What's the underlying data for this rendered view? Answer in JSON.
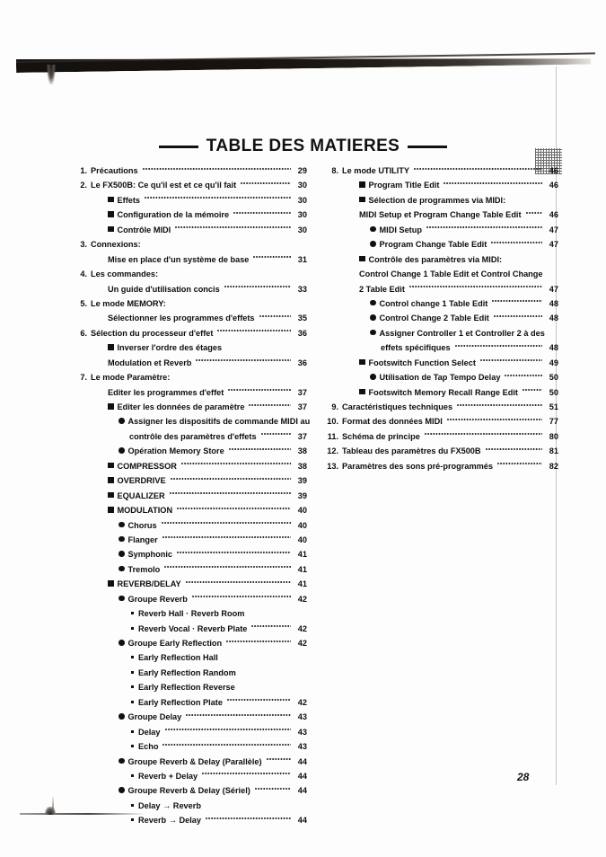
{
  "document": {
    "title": "TABLE DES MATIERES",
    "page_number": "28"
  },
  "toc": {
    "left_column": [
      {
        "num": "1.",
        "bullet": "none",
        "indent": 0,
        "label": "Précautions",
        "page": "29",
        "leader": true
      },
      {
        "num": "2.",
        "bullet": "none",
        "indent": 0,
        "label": "Le FX500B: Ce qu'il est et ce qu'il fait",
        "page": "30",
        "leader": true
      },
      {
        "num": "",
        "bullet": "square",
        "indent": 1,
        "label": "Effets",
        "page": "30",
        "leader": true
      },
      {
        "num": "",
        "bullet": "square",
        "indent": 1,
        "label": "Configuration de la mémoire",
        "page": "30",
        "leader": true
      },
      {
        "num": "",
        "bullet": "square",
        "indent": 1,
        "label": "Contrôle MIDI",
        "page": "30",
        "leader": true
      },
      {
        "num": "3.",
        "bullet": "none",
        "indent": 0,
        "label": "Connexions:",
        "page": "",
        "leader": false
      },
      {
        "num": "",
        "bullet": "none",
        "indent": 2,
        "label": "Mise en place d'un système de base",
        "page": "31",
        "leader": true
      },
      {
        "num": "4.",
        "bullet": "none",
        "indent": 0,
        "label": "Les commandes:",
        "page": "",
        "leader": false
      },
      {
        "num": "",
        "bullet": "none",
        "indent": 2,
        "label": "Un guide d'utilisation concis",
        "page": "33",
        "leader": true
      },
      {
        "num": "5.",
        "bullet": "none",
        "indent": 0,
        "label": "Le mode MEMORY:",
        "page": "",
        "leader": false
      },
      {
        "num": "",
        "bullet": "none",
        "indent": 2,
        "label": "Sélectionner les programmes d'effets",
        "page": "35",
        "leader": true
      },
      {
        "num": "6.",
        "bullet": "none",
        "indent": 0,
        "label": "Sélection du processeur d'effet",
        "page": "36",
        "leader": true
      },
      {
        "num": "",
        "bullet": "square",
        "indent": 1,
        "label": "Inverser l'ordre des étages",
        "page": "",
        "leader": false
      },
      {
        "num": "",
        "bullet": "none",
        "indent": 2,
        "label": "Modulation et Reverb",
        "page": "36",
        "leader": true
      },
      {
        "num": "7.",
        "bullet": "none",
        "indent": 0,
        "label": "Le mode Paramètre:",
        "page": "",
        "leader": false
      },
      {
        "num": "",
        "bullet": "none",
        "indent": 2,
        "label": "Editer les programmes d'effet",
        "page": "37",
        "leader": true
      },
      {
        "num": "",
        "bullet": "square",
        "indent": 1,
        "label": "Editer les données de paramètre",
        "page": "37",
        "leader": true
      },
      {
        "num": "",
        "bullet": "disc",
        "indent": 3,
        "label": "Assigner les dispositifs de commande MIDI au",
        "page": "",
        "leader": false
      },
      {
        "num": "",
        "bullet": "none",
        "indent": 4,
        "label": "contrôle des paramètres d'effets",
        "page": "37",
        "leader": true
      },
      {
        "num": "",
        "bullet": "disc",
        "indent": 3,
        "label": "Opération Memory Store",
        "page": "38",
        "leader": true
      },
      {
        "num": "",
        "bullet": "square",
        "indent": 1,
        "label": "COMPRESSOR",
        "page": "38",
        "leader": true
      },
      {
        "num": "",
        "bullet": "square",
        "indent": 1,
        "label": "OVERDRIVE",
        "page": "39",
        "leader": true
      },
      {
        "num": "",
        "bullet": "square",
        "indent": 1,
        "label": "EQUALIZER",
        "page": "39",
        "leader": true
      },
      {
        "num": "",
        "bullet": "square",
        "indent": 1,
        "label": "MODULATION",
        "page": "40",
        "leader": true
      },
      {
        "num": "",
        "bullet": "disc",
        "indent": 3,
        "label": "Chorus",
        "page": "40",
        "leader": true
      },
      {
        "num": "",
        "bullet": "disc",
        "indent": 3,
        "label": "Flanger",
        "page": "40",
        "leader": true
      },
      {
        "num": "",
        "bullet": "disc",
        "indent": 3,
        "label": "Symphonic",
        "page": "41",
        "leader": true
      },
      {
        "num": "",
        "bullet": "disc",
        "indent": 3,
        "label": "Tremolo",
        "page": "41",
        "leader": true
      },
      {
        "num": "",
        "bullet": "square",
        "indent": 1,
        "label": "REVERB/DELAY",
        "page": "41",
        "leader": true
      },
      {
        "num": "",
        "bullet": "disc",
        "indent": 3,
        "label": "Groupe Reverb",
        "page": "42",
        "leader": true
      },
      {
        "num": "",
        "bullet": "dash",
        "indent": 4,
        "label": "Reverb Hall · Reverb Room",
        "page": "",
        "leader": false
      },
      {
        "num": "",
        "bullet": "dash",
        "indent": 4,
        "label": "Reverb Vocal · Reverb Plate",
        "page": "42",
        "leader": true
      },
      {
        "num": "",
        "bullet": "disc",
        "indent": 3,
        "label": "Groupe Early Reflection",
        "page": "42",
        "leader": true
      },
      {
        "num": "",
        "bullet": "dash",
        "indent": 4,
        "label": "Early Reflection Hall",
        "page": "",
        "leader": false
      },
      {
        "num": "",
        "bullet": "dash",
        "indent": 4,
        "label": "Early Reflection Random",
        "page": "",
        "leader": false
      },
      {
        "num": "",
        "bullet": "dash",
        "indent": 4,
        "label": "Early Reflection Reverse",
        "page": "",
        "leader": false
      },
      {
        "num": "",
        "bullet": "dash",
        "indent": 4,
        "label": "Early Reflection Plate",
        "page": "42",
        "leader": true
      },
      {
        "num": "",
        "bullet": "disc",
        "indent": 3,
        "label": "Groupe Delay",
        "page": "43",
        "leader": true
      },
      {
        "num": "",
        "bullet": "dash",
        "indent": 4,
        "label": "Delay",
        "page": "43",
        "leader": true
      },
      {
        "num": "",
        "bullet": "dash",
        "indent": 4,
        "label": "Echo",
        "page": "43",
        "leader": true
      },
      {
        "num": "",
        "bullet": "disc",
        "indent": 3,
        "label": "Groupe Reverb & Delay (Parallèle)",
        "page": "44",
        "leader": true
      },
      {
        "num": "",
        "bullet": "dash",
        "indent": 4,
        "label": "Reverb + Delay",
        "page": "44",
        "leader": true
      },
      {
        "num": "",
        "bullet": "disc",
        "indent": 3,
        "label": "Groupe Reverb & Delay (Sériel)",
        "page": "44",
        "leader": true
      },
      {
        "num": "",
        "bullet": "dash",
        "indent": 4,
        "label": "Delay → Reverb",
        "page": "",
        "leader": false
      },
      {
        "num": "",
        "bullet": "dash",
        "indent": 4,
        "label": "Reverb → Delay",
        "page": "44",
        "leader": true
      }
    ],
    "right_column": [
      {
        "num": "8.",
        "bullet": "none",
        "indent": 0,
        "label": "Le mode UTILITY",
        "page": "46",
        "leader": true
      },
      {
        "num": "",
        "bullet": "square",
        "indent": 1,
        "label": "Program Title Edit",
        "page": "46",
        "leader": true
      },
      {
        "num": "",
        "bullet": "square",
        "indent": 1,
        "label": "Sélection de programmes via MIDI:",
        "page": "",
        "leader": false
      },
      {
        "num": "",
        "bullet": "none",
        "indent": 2,
        "label": "MIDI Setup et Program Change Table Edit",
        "page": "46",
        "leader": true
      },
      {
        "num": "",
        "bullet": "disc",
        "indent": 3,
        "label": "MIDI Setup",
        "page": "47",
        "leader": true
      },
      {
        "num": "",
        "bullet": "disc",
        "indent": 3,
        "label": "Program Change Table Edit",
        "page": "47",
        "leader": true
      },
      {
        "num": "",
        "bullet": "square",
        "indent": 1,
        "label": "Contrôle des paramètres via MIDI:",
        "page": "",
        "leader": false
      },
      {
        "num": "",
        "bullet": "none",
        "indent": 2,
        "label": "Control Change 1 Table Edit et Control Change",
        "page": "",
        "leader": false
      },
      {
        "num": "",
        "bullet": "none",
        "indent": 2,
        "label": "2 Table Edit",
        "page": "47",
        "leader": true
      },
      {
        "num": "",
        "bullet": "disc",
        "indent": 3,
        "label": "Control change 1 Table Edit",
        "page": "48",
        "leader": true
      },
      {
        "num": "",
        "bullet": "disc",
        "indent": 3,
        "label": "Control Change 2 Table Edit",
        "page": "48",
        "leader": true
      },
      {
        "num": "",
        "bullet": "disc",
        "indent": 3,
        "label": "Assigner Controller 1 et Controller 2 à des",
        "page": "",
        "leader": false
      },
      {
        "num": "",
        "bullet": "none",
        "indent": 4,
        "label": "effets spécifiques",
        "page": "48",
        "leader": true
      },
      {
        "num": "",
        "bullet": "square",
        "indent": 1,
        "label": "Footswitch Function Select",
        "page": "49",
        "leader": true
      },
      {
        "num": "",
        "bullet": "disc",
        "indent": 3,
        "label": "Utilisation de Tap Tempo Delay",
        "page": "50",
        "leader": true
      },
      {
        "num": "",
        "bullet": "square",
        "indent": 1,
        "label": "Footswitch Memory Recall Range Edit",
        "page": "50",
        "leader": true
      },
      {
        "num": "9.",
        "bullet": "none",
        "indent": 0,
        "label": "Caractéristiques techniques",
        "page": "51",
        "leader": true
      },
      {
        "num": "10.",
        "bullet": "none",
        "indent": 0,
        "label": "Format des données MIDI",
        "page": "77",
        "leader": true
      },
      {
        "num": "11.",
        "bullet": "none",
        "indent": 0,
        "label": "Schéma de principe",
        "page": "80",
        "leader": true
      },
      {
        "num": "12.",
        "bullet": "none",
        "indent": 0,
        "label": "Tableau des paramètres du FX500B",
        "page": "81",
        "leader": true
      },
      {
        "num": "13.",
        "bullet": "none",
        "indent": 0,
        "label": "Paramètres des sons pré-programmés",
        "page": "82",
        "leader": true
      }
    ]
  }
}
